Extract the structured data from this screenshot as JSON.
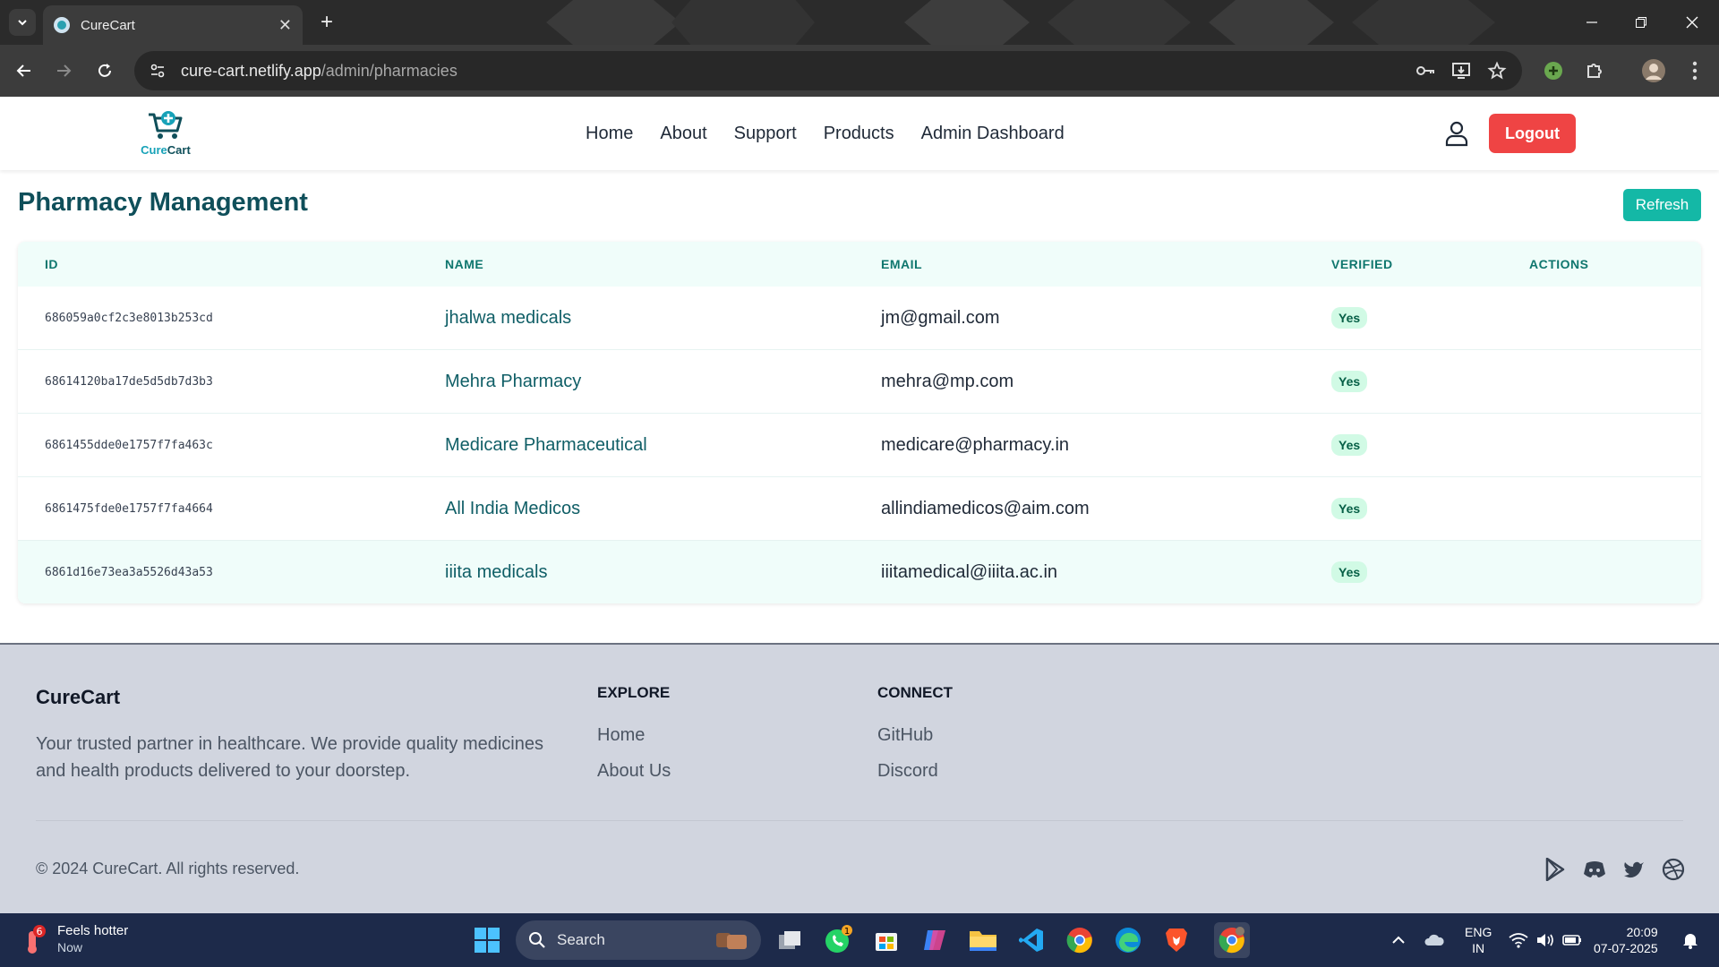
{
  "browser": {
    "tab_title": "CureCart",
    "url_host": "cure-cart.netlify.app",
    "url_path": "/admin/pharmacies"
  },
  "header": {
    "logo_text_a": "Cure",
    "logo_text_b": "Cart",
    "nav": [
      "Home",
      "About",
      "Support",
      "Products",
      "Admin Dashboard"
    ],
    "logout_label": "Logout"
  },
  "main": {
    "title": "Pharmacy Management",
    "refresh_label": "Refresh",
    "columns": [
      "ID",
      "NAME",
      "EMAIL",
      "VERIFIED",
      "ACTIONS"
    ],
    "rows": [
      {
        "id": "686059a0cf2c3e8013b253cd",
        "name": "jhalwa medicals",
        "email": "jm@gmail.com",
        "verified": "Yes"
      },
      {
        "id": "68614120ba17de5d5db7d3b3",
        "name": "Mehra Pharmacy",
        "email": "mehra@mp.com",
        "verified": "Yes"
      },
      {
        "id": "6861455dde0e1757f7fa463c",
        "name": "Medicare Pharmaceutical",
        "email": "medicare@pharmacy.in",
        "verified": "Yes"
      },
      {
        "id": "6861475fde0e1757f7fa4664",
        "name": "All India Medicos",
        "email": "allindiamedicos@aim.com",
        "verified": "Yes"
      },
      {
        "id": "6861d16e73ea3a5526d43a53",
        "name": "iiita medicals",
        "email": "iiitamedical@iiita.ac.in",
        "verified": "Yes"
      }
    ]
  },
  "footer": {
    "brand": "CureCart",
    "description": "Your trusted partner in healthcare. We provide quality medicines and health products delivered to your doorstep.",
    "explore_title": "EXPLORE",
    "explore_links": [
      "Home",
      "About Us"
    ],
    "connect_title": "CONNECT",
    "connect_links": [
      "GitHub",
      "Discord"
    ],
    "copyright": "© 2024 CureCart. All rights reserved."
  },
  "taskbar": {
    "weather_badge": "6",
    "weather_title": "Feels hotter",
    "weather_sub": "Now",
    "search_label": "Search",
    "whatsapp_badge": "1",
    "lang_1": "ENG",
    "lang_2": "IN",
    "time": "20:09",
    "date": "07-07-2025"
  },
  "colors": {
    "brand_teal": "#0f4f5a",
    "logout_red": "#ef4444",
    "refresh_teal": "#14b8a6",
    "badge_green": "#d1fae5"
  }
}
